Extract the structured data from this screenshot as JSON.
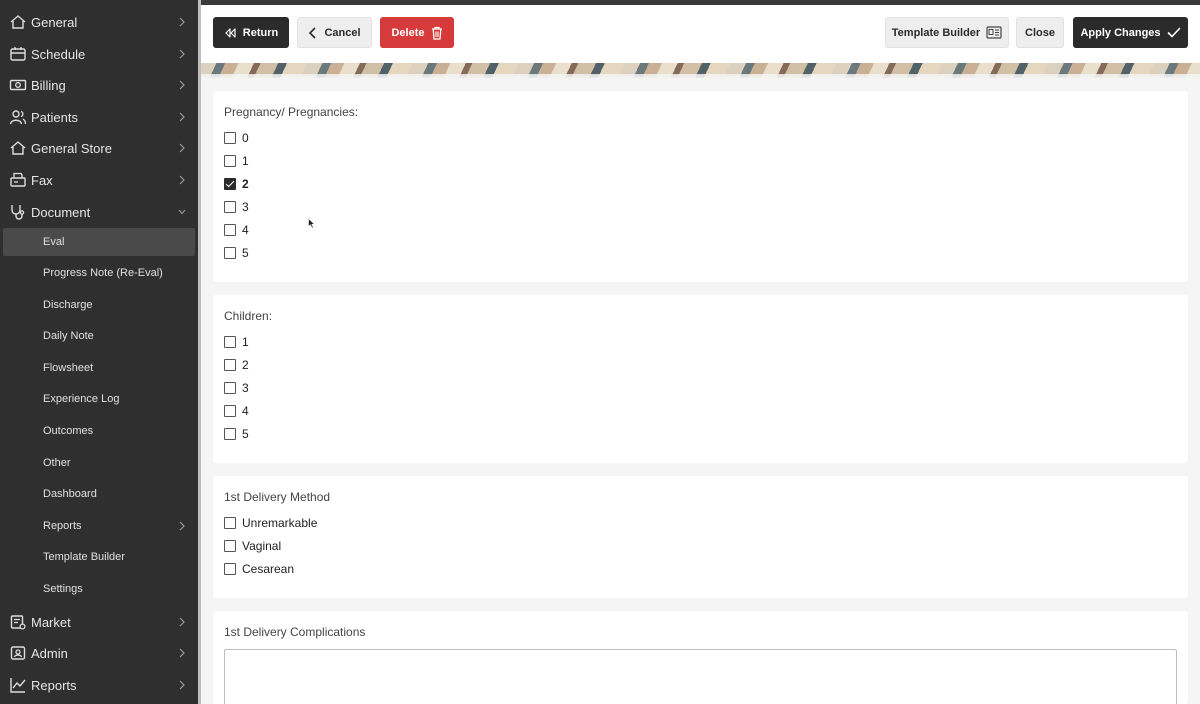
{
  "sidebar": {
    "items": [
      {
        "label": "General",
        "icon": "home-icon"
      },
      {
        "label": "Schedule",
        "icon": "calendar-icon"
      },
      {
        "label": "Billing",
        "icon": "money-icon"
      },
      {
        "label": "Patients",
        "icon": "users-icon"
      },
      {
        "label": "General Store",
        "icon": "store-icon"
      },
      {
        "label": "Fax",
        "icon": "fax-icon"
      },
      {
        "label": "Document",
        "icon": "stethoscope-icon"
      }
    ],
    "document_sub": [
      {
        "label": "Eval"
      },
      {
        "label": "Progress Note (Re-Eval)"
      },
      {
        "label": "Discharge"
      },
      {
        "label": "Daily Note"
      },
      {
        "label": "Flowsheet"
      },
      {
        "label": "Experience Log"
      },
      {
        "label": "Outcomes"
      },
      {
        "label": "Other"
      },
      {
        "label": "Dashboard"
      },
      {
        "label": "Reports"
      },
      {
        "label": "Template Builder"
      },
      {
        "label": "Settings"
      }
    ],
    "bottom_items": [
      {
        "label": "Market",
        "icon": "market-icon"
      },
      {
        "label": "Admin",
        "icon": "admin-icon"
      },
      {
        "label": "Reports",
        "icon": "chart-icon"
      }
    ]
  },
  "toolbar": {
    "return_label": "Return",
    "cancel_label": "Cancel",
    "delete_label": "Delete",
    "template_builder_label": "Template Builder",
    "close_label": "Close",
    "apply_label": "Apply Changes"
  },
  "form": {
    "pregnancies": {
      "title": "Pregnancy/ Pregnancies:",
      "options": [
        "0",
        "1",
        "2",
        "3",
        "4",
        "5"
      ],
      "checked": "2"
    },
    "children": {
      "title": "Children:",
      "options": [
        "1",
        "2",
        "3",
        "4",
        "5"
      ]
    },
    "delivery_method": {
      "title": "1st Delivery Method",
      "options": [
        "Unremarkable",
        "Vaginal",
        "Cesarean"
      ]
    },
    "complications": {
      "title": "1st Delivery Complications",
      "value": ""
    }
  },
  "colors": {
    "sidebar_bg": "#2f2f2f",
    "dark_button": "#2b2b2b",
    "delete_button": "#d63a3a"
  }
}
